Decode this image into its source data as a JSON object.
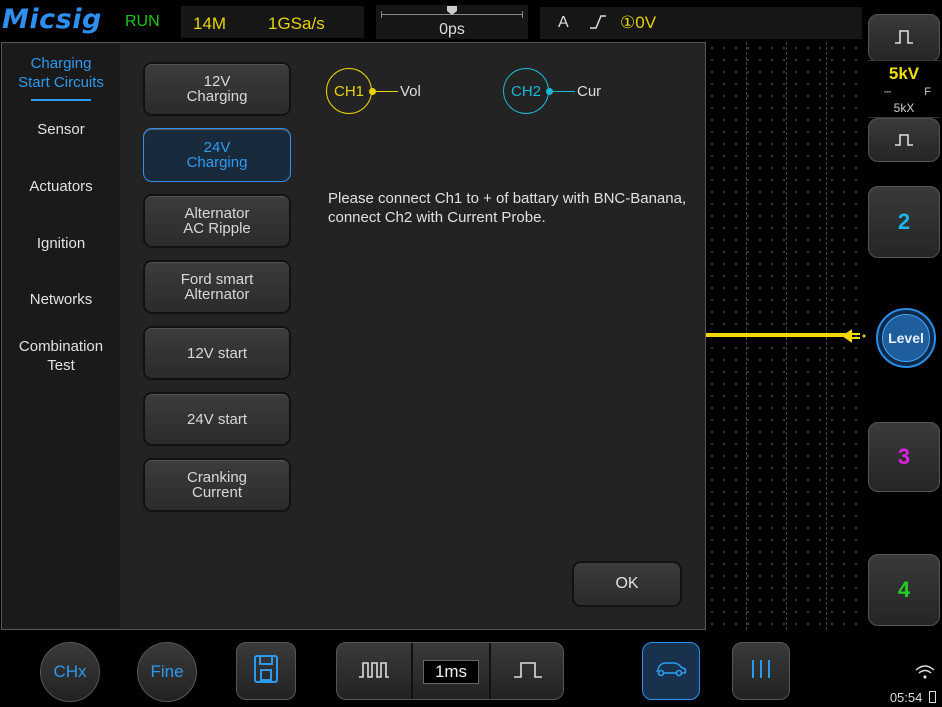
{
  "topbar": {
    "logo": "Micsig",
    "status": "RUN",
    "memory_depth": "14M",
    "sample_rate": "1GSa/s",
    "time_offset": "0ps",
    "trigger_source": "A",
    "trigger_level": "①0V"
  },
  "dialog": {
    "sidebar": [
      {
        "label": "Charging\nStart Circuits",
        "active": true
      },
      {
        "label": "Sensor"
      },
      {
        "label": "Actuators"
      },
      {
        "label": "Ignition"
      },
      {
        "label": "Networks"
      },
      {
        "label": "Combination\nTest"
      }
    ],
    "tests": [
      {
        "label": "12V\nCharging"
      },
      {
        "label": "24V\nCharging",
        "active": true
      },
      {
        "label": "Alternator\nAC Ripple"
      },
      {
        "label": "Ford smart\nAlternator"
      },
      {
        "label": "12V start"
      },
      {
        "label": "24V start"
      },
      {
        "label": "Cranking\nCurrent"
      }
    ],
    "probes": [
      {
        "channel": "CH1",
        "signal": "Vol",
        "color": "#e8d200"
      },
      {
        "channel": "CH2",
        "signal": "Cur",
        "color": "#19b8d8"
      }
    ],
    "instructions": "Please connect Ch1 to + of battary with BNC-Banana, connect Ch2 with Current Probe.",
    "ok_label": "OK"
  },
  "right_panel": {
    "ch1_volts": "5kV",
    "ch1_bw": "F",
    "ch1_probe": "5kX",
    "ch2_label": "2",
    "level_label": "Level",
    "ch3_label": "3",
    "ch4_label": "4",
    "colors": {
      "ch1": "#f0e000",
      "ch2": "#19b8e8",
      "ch3": "#e020e0",
      "ch4": "#22cc22"
    }
  },
  "bottombar": {
    "chx_label": "CHx",
    "fine_label": "Fine",
    "timebase": "1ms",
    "clock": "05:54"
  },
  "icons": [
    "pulse-wide-icon",
    "pulse-narrow-icon",
    "save-icon",
    "car-icon",
    "cursor-lines-icon",
    "wifi-icon",
    "trigger-rising-edge-icon"
  ]
}
